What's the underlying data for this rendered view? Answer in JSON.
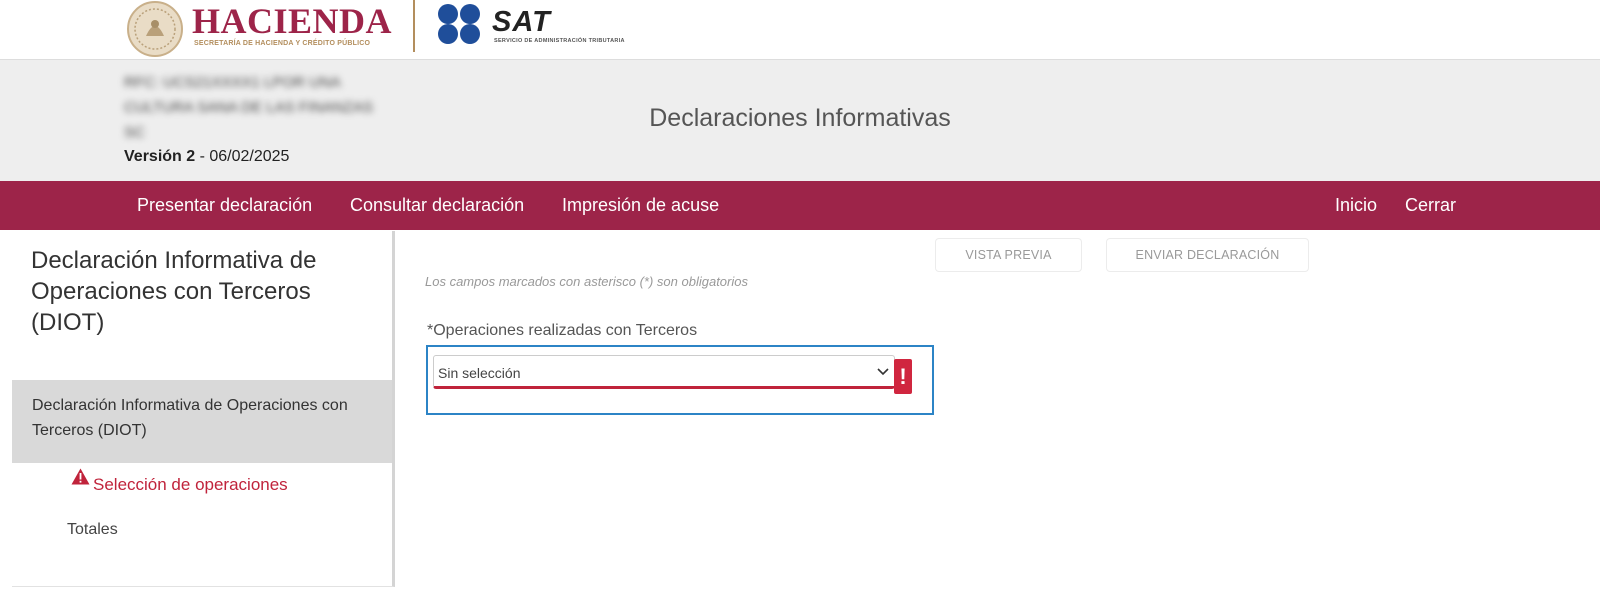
{
  "header": {
    "hacienda_title": "HACIENDA",
    "hacienda_subtitle": "SECRETARÍA DE HACIENDA Y CRÉDITO PÚBLICO",
    "sat_title": "SAT",
    "sat_subtitle": "SERVICIO DE ADMINISTRACIÓN TRIBUTARIA"
  },
  "banner": {
    "rfc_blurred_lines": [
      "RFC: UCS21XXXX1 LPOR UNA",
      "CULTURA SANA DE LAS FINANZAS",
      "SC"
    ],
    "version_label": "Versión 2",
    "version_date": " - 06/02/2025",
    "title": "Declaraciones Informativas"
  },
  "nav": {
    "items": [
      "Presentar declaración",
      "Consultar declaración",
      "Impresión de acuse"
    ],
    "right_items": [
      "Inicio",
      "Cerrar"
    ]
  },
  "sidebar": {
    "heading": "Declaración Informativa de Operaciones con Terceros (DIOT)",
    "section_label": "Declaración Informativa de Operaciones con Terceros (DIOT)",
    "links": [
      "Selección de operaciones",
      "Totales"
    ]
  },
  "main": {
    "preview_button": "VISTA PREVIA",
    "send_button": "ENVIAR DECLARACIÓN",
    "required_note": "Los campos marcados con asterisco (*) son obligatorios",
    "field_label": "*Operaciones realizadas con Terceros",
    "select_value": "Sin selección",
    "error_mark": "!"
  },
  "colors": {
    "brand": "#9d2449",
    "gold": "#b38e5d",
    "error": "#c0233b",
    "focus": "#2c84c6",
    "banner_bg": "#eeeeee"
  },
  "icons": {
    "seal": "mexican-coat-of-arms-icon",
    "sat_logo": "sat-dots-icon",
    "warning": "warning-triangle-icon",
    "chevron": "chevron-down-icon"
  }
}
